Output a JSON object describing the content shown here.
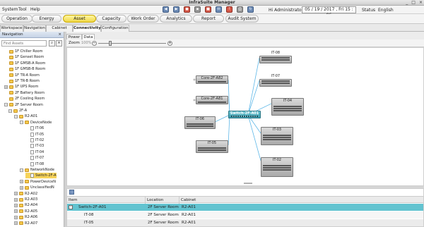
{
  "window": {
    "title": "InfraSuite Manager",
    "controls": [
      "_",
      "□",
      "×"
    ]
  },
  "menu": {
    "items": [
      "System",
      "Tool",
      "Help"
    ]
  },
  "toolbar": {
    "icons": [
      "prev-icon",
      "next-icon",
      "record-icon",
      "lock-icon",
      "stop-icon",
      "message-icon",
      "alarm-icon",
      "print-icon",
      "refresh-icon"
    ],
    "greeting": "Hi Administrator",
    "date_time": "05 / 19 / 2017 , Fri   15 : 06",
    "status_label": "Status",
    "status_value": "English"
  },
  "modules": {
    "tabs": [
      "Operation",
      "Energy",
      "Asset",
      "Capacity",
      "Work Order",
      "Analytics",
      "Report",
      "Audit System"
    ],
    "active": "Asset"
  },
  "view_tabs": {
    "items": [
      "Workspace",
      "Navigation",
      "Cabinet View",
      "Connectivity",
      "Configuration"
    ],
    "active": "Connectivity"
  },
  "navigation": {
    "title": "Navigation",
    "close": "×",
    "search_placeholder": "Find Assets",
    "tree": [
      {
        "label": "1F Chiller Room",
        "type": "folder",
        "level": 1
      },
      {
        "label": "1F Genset Room",
        "type": "folder",
        "level": 1
      },
      {
        "label": "1F GMSB-A Room",
        "type": "folder",
        "level": 1
      },
      {
        "label": "1F GMSB-B Room",
        "type": "folder",
        "level": 1
      },
      {
        "label": "1F TR-A Room",
        "type": "folder",
        "level": 1
      },
      {
        "label": "1F TR-B Room",
        "type": "folder",
        "level": 1
      },
      {
        "label": "1F UPS Room",
        "type": "folder",
        "level": 1,
        "expander": "+"
      },
      {
        "label": "2F Battery Room",
        "type": "folder",
        "level": 1
      },
      {
        "label": "2F Cooling Room",
        "type": "folder",
        "level": 1
      },
      {
        "label": "2F Server Room",
        "type": "folder",
        "level": 1,
        "expander": "−"
      },
      {
        "label": "2F-A",
        "type": "folder",
        "level": 2,
        "expander": "−"
      },
      {
        "label": "R2-A01",
        "type": "folder",
        "level": 3,
        "expander": "−"
      },
      {
        "label": "DeviceNode",
        "type": "folder",
        "level": 4,
        "expander": "−"
      },
      {
        "label": "IT-06",
        "type": "leaf",
        "level": 5
      },
      {
        "label": "IT-05",
        "type": "leaf",
        "level": 5
      },
      {
        "label": "IT-02",
        "type": "leaf",
        "level": 5
      },
      {
        "label": "IT-03",
        "type": "leaf",
        "level": 5
      },
      {
        "label": "IT-04",
        "type": "leaf",
        "level": 5
      },
      {
        "label": "IT-07",
        "type": "leaf",
        "level": 5
      },
      {
        "label": "IT-08",
        "type": "leaf",
        "level": 5
      },
      {
        "label": "NetworkNode",
        "type": "folder",
        "level": 4,
        "expander": "−"
      },
      {
        "label": "Switch-2F-A",
        "type": "leaf",
        "level": 5,
        "selected": true
      },
      {
        "label": "PowerDeviceN",
        "type": "folder",
        "level": 4,
        "expander": "+"
      },
      {
        "label": "UnclassifiedN",
        "type": "folder",
        "level": 4,
        "expander": "+"
      },
      {
        "label": "R2-A02",
        "type": "folder",
        "level": 3,
        "expander": "+"
      },
      {
        "label": "R2-A03",
        "type": "folder",
        "level": 3,
        "expander": "+"
      },
      {
        "label": "R2-A04",
        "type": "folder",
        "level": 3,
        "expander": "+"
      },
      {
        "label": "R2-A05",
        "type": "folder",
        "level": 3,
        "expander": "+"
      },
      {
        "label": "R2-A06",
        "type": "folder",
        "level": 3,
        "expander": "+"
      },
      {
        "label": "R2-A07",
        "type": "folder",
        "level": 3,
        "expander": "+"
      }
    ]
  },
  "content_tabs": {
    "items": [
      "Power",
      "Data"
    ],
    "active": "Data"
  },
  "zoom": {
    "label": "Zoom",
    "value": "100%"
  },
  "topology": {
    "hub": "Switch-2F-A01",
    "devices": [
      "IT-08",
      "IT-07",
      "IT-04",
      "IT-03",
      "IT-02",
      "IT-06",
      "IT-05",
      "Core-2F-A82",
      "Core-2F-A81"
    ]
  },
  "table": {
    "columns": [
      "Item",
      "Location",
      "Cabinet"
    ],
    "rows": [
      {
        "item": "Switch-2F-A01",
        "location": "2F Server Room",
        "cabinet": "R2-A01",
        "highlight": true,
        "expander": "−"
      },
      {
        "item": "IT-08",
        "location": "2F Server Room",
        "cabinet": "R2-A01"
      },
      {
        "item": "IT-05",
        "location": "2F Server Room",
        "cabinet": "R2-A01"
      }
    ]
  },
  "colors": {
    "accent": "#f0d848",
    "hub": "#4aa8b8",
    "link": "#5fb8e8",
    "selected_row": "#62c3d0"
  }
}
